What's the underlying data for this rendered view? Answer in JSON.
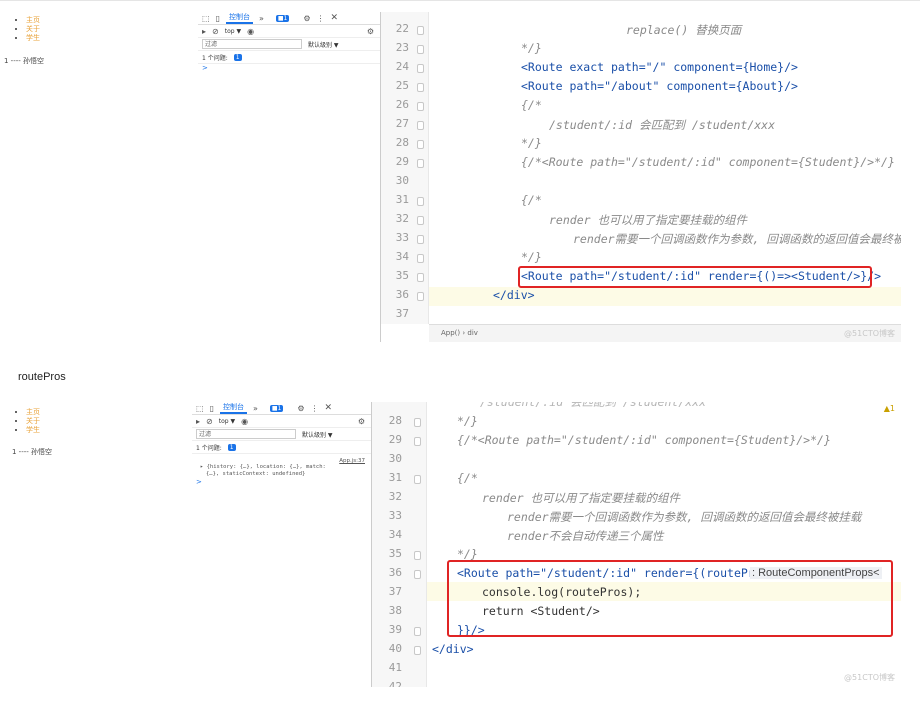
{
  "panel1": {
    "preview": {
      "nav_items": [
        "主页",
        "关于",
        "学生"
      ],
      "person_line": "1 ---- 孙悟空"
    },
    "devtools": {
      "tab_console": "控制台",
      "context": "top ▼",
      "filter_placeholder": "过滤",
      "levels": "默认级别 ▼",
      "issues_label": "1 个问题:",
      "issues_badge": "1",
      "prompt": ">"
    },
    "editor": {
      "lines": [
        {
          "n": "22",
          "t": "replace() 替换页面"
        },
        {
          "n": "23",
          "t": "*/}"
        },
        {
          "n": "24",
          "t": "<Route exact path=\"/\" component={Home}/>"
        },
        {
          "n": "25",
          "t": "<Route path=\"/about\" component={About}/>"
        },
        {
          "n": "26",
          "t": "{/*"
        },
        {
          "n": "27",
          "t": "/student/:id 会匹配到 /student/xxx"
        },
        {
          "n": "28",
          "t": "*/}"
        },
        {
          "n": "29",
          "t": "{/*<Route path=\"/student/:id\" component={Student}/>*/}"
        },
        {
          "n": "30",
          "t": ""
        },
        {
          "n": "31",
          "t": "{/*"
        },
        {
          "n": "32",
          "t": "render 也可以用了指定要挂载的组件"
        },
        {
          "n": "33",
          "t": "render需要一个回调函数作为参数, 回调函数的返回值会最终被挂"
        },
        {
          "n": "34",
          "t": "*/}"
        },
        {
          "n": "35",
          "t": "<Route path=\"/student/:id\" render={()=><Student/>}/>"
        },
        {
          "n": "36",
          "t": "</div>"
        },
        {
          "n": "37",
          "t": ""
        }
      ],
      "breadcrumb": "App() › div",
      "watermark": "@51CTO博客"
    }
  },
  "caption": "routePros",
  "panel2": {
    "preview": {
      "nav_items": [
        "主页",
        "关于",
        "学生"
      ],
      "person_line": "1 ---- 孙悟空"
    },
    "devtools": {
      "tab_console": "控制台",
      "context": "top ▼",
      "filter_placeholder": "过滤",
      "levels": "默认级别 ▼",
      "issues_label": "1 个问题:",
      "issues_badge": "1",
      "log_source": "App.js:37",
      "log_text_1": "{history: {…}, location: {…}, match:",
      "log_text_2": "{…}, staticContext: undefined}",
      "prompt": ">"
    },
    "editor": {
      "top_partial": "/student/:id 会匹配到 /student/xxx",
      "lines": [
        {
          "n": "28",
          "t": "*/}"
        },
        {
          "n": "29",
          "t": "{/*<Route path=\"/student/:id\" component={Student}/>*/}"
        },
        {
          "n": "30",
          "t": ""
        },
        {
          "n": "31",
          "t": "{/*"
        },
        {
          "n": "32",
          "t": "render 也可以用了指定要挂载的组件"
        },
        {
          "n": "33",
          "t": "render需要一个回调函数作为参数, 回调函数的返回值会最终被挂载"
        },
        {
          "n": "34",
          "t": "render不会自动传递三个属性"
        },
        {
          "n": "35",
          "t": "*/}"
        },
        {
          "n": "36",
          "t": "<Route path=\"/student/:id\" render={(routePros"
        },
        {
          "n": "37",
          "t": "console.log(routePros);"
        },
        {
          "n": "38",
          "t": "return <Student/>"
        },
        {
          "n": "39",
          "t": "}}/>"
        },
        {
          "n": "40",
          "t": "</div>"
        },
        {
          "n": "41",
          "t": ""
        },
        {
          "n": "42",
          "t": ""
        }
      ],
      "type_hint": ": RouteComponentProps<",
      "warning_count": "1",
      "watermark": "@51CTO博客"
    }
  }
}
